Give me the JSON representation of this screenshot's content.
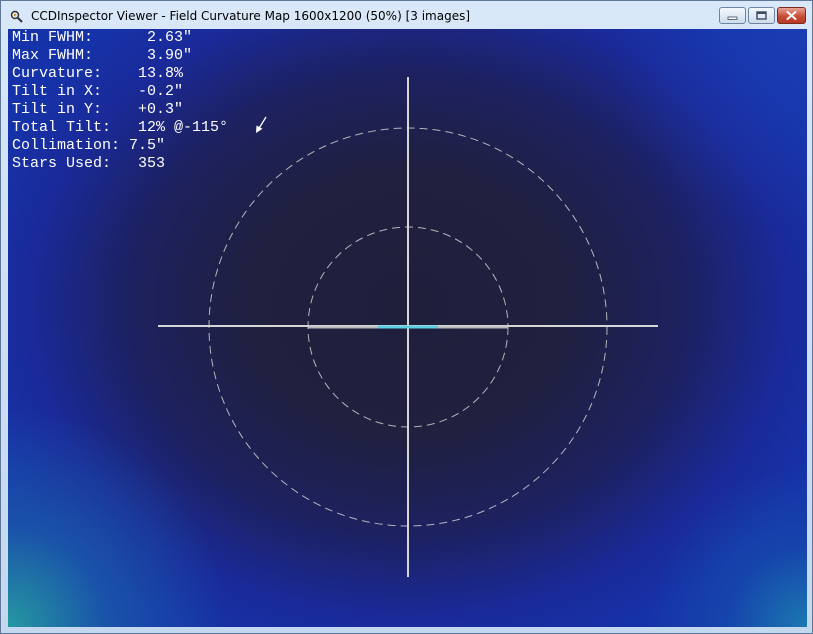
{
  "window": {
    "title": "CCDInspector Viewer - Field Curvature Map 1600x1200 (50%)  [3 images]",
    "controls": [
      "minimize",
      "maximize",
      "close"
    ]
  },
  "stats": [
    {
      "label": "Min FWHM:      ",
      "value": "2.63\""
    },
    {
      "label": "Max FWHM:      ",
      "value": "3.90\""
    },
    {
      "label": "Curvature:    ",
      "value": "13.8%"
    },
    {
      "label": "Tilt in X:    ",
      "value": "-0.2\""
    },
    {
      "label": "Tilt in Y:    ",
      "value": "+0.3\""
    },
    {
      "label": "Total Tilt:   ",
      "value": "12% @-115°"
    },
    {
      "label": "Collimation: ",
      "value": "7.5\""
    },
    {
      "label": "Stars Used:   ",
      "value": "353"
    }
  ],
  "map": {
    "colors": {
      "center": "#1f1f3c",
      "edge": "#1a2a9a",
      "corner": "#2aa9a0",
      "crosshair": "#d6d6d6",
      "center_mark": "#5bd0e0"
    },
    "tilt_direction_deg": -115,
    "icons": [
      "tilt-arrow-icon"
    ]
  }
}
